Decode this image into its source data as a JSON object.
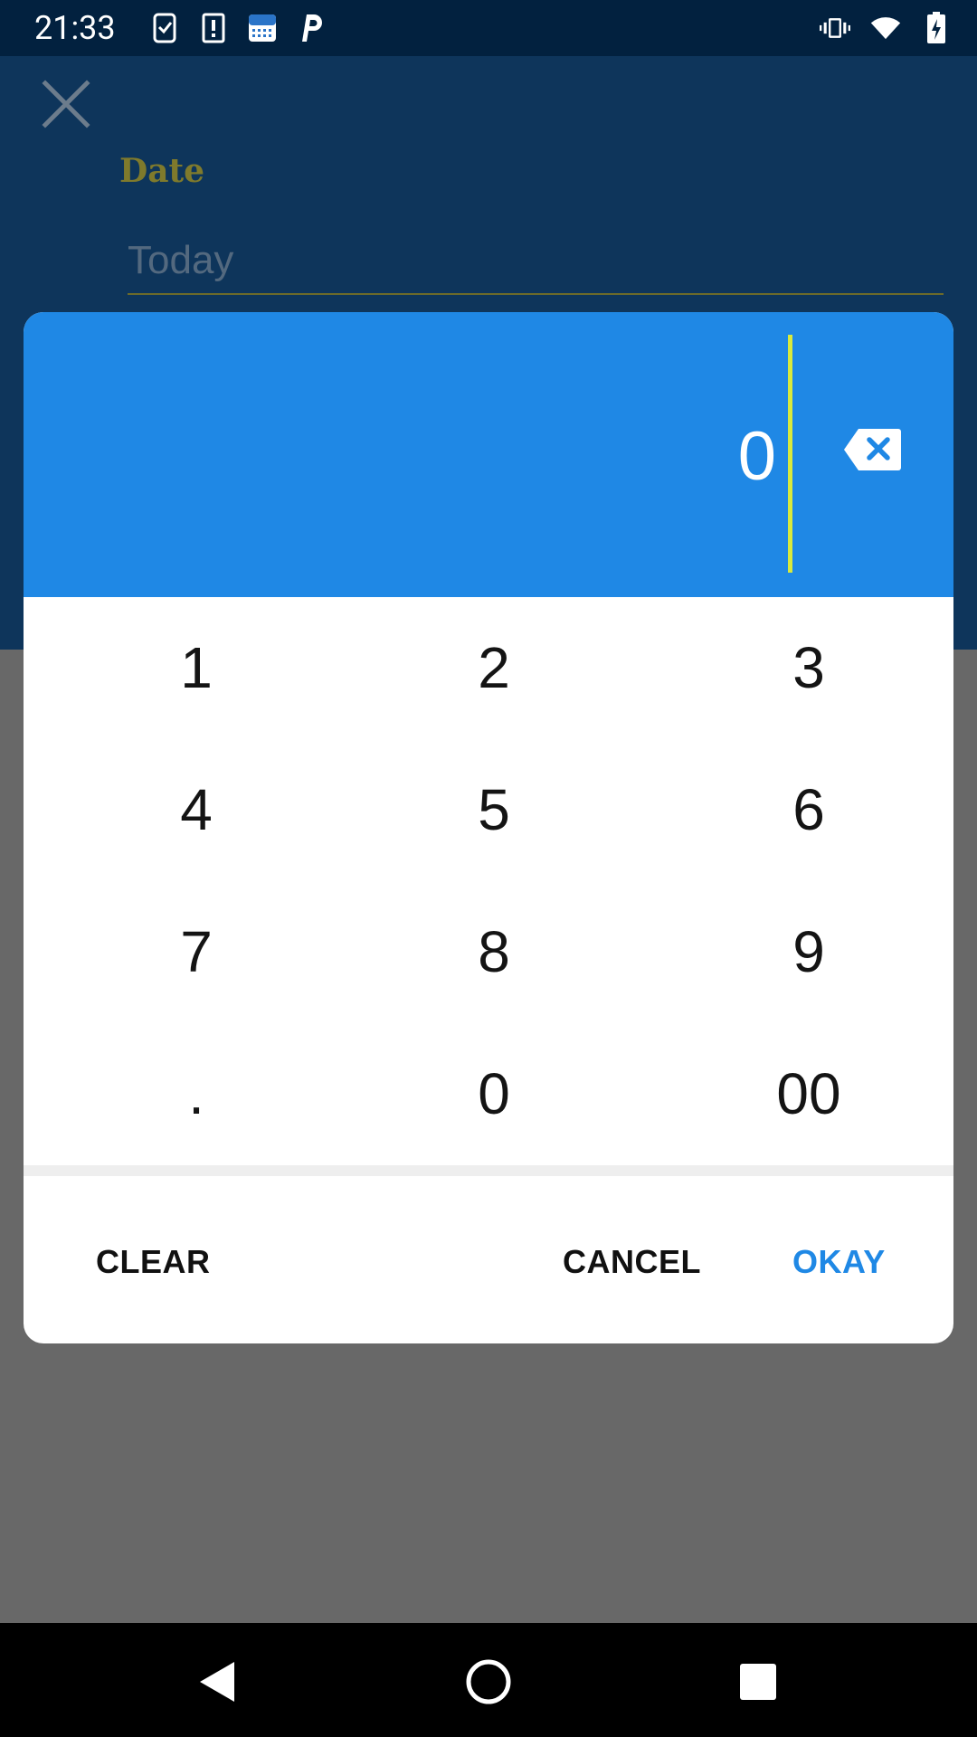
{
  "status_bar": {
    "time": "21:33",
    "left_icons": [
      "task-check-icon",
      "alert-icon",
      "calendar-cloud-icon",
      "parking-p-icon"
    ],
    "right_icons": [
      "vibrate-icon",
      "wifi-icon",
      "battery-charging-icon"
    ]
  },
  "background_form": {
    "close_icon": "close-icon",
    "date_label": "Date",
    "date_value": "Today"
  },
  "dialog": {
    "display_value": "0",
    "backspace_icon": "backspace-icon",
    "keys": [
      "1",
      "2",
      "3",
      "4",
      "5",
      "6",
      "7",
      "8",
      "9",
      ".",
      "0",
      "00"
    ],
    "actions": {
      "clear": "CLEAR",
      "cancel": "CANCEL",
      "okay": "OKAY"
    }
  },
  "nav_bar": {
    "icons": [
      "back-icon",
      "home-icon",
      "recents-icon"
    ]
  },
  "colors": {
    "status_bar": "#02213f",
    "app_header": "#0e355b",
    "display": "#1f88e5",
    "cursor": "#d8ea3d",
    "accent_text": "#1f88e5",
    "date_label": "#7f7a2c",
    "scrim": "#686868"
  }
}
